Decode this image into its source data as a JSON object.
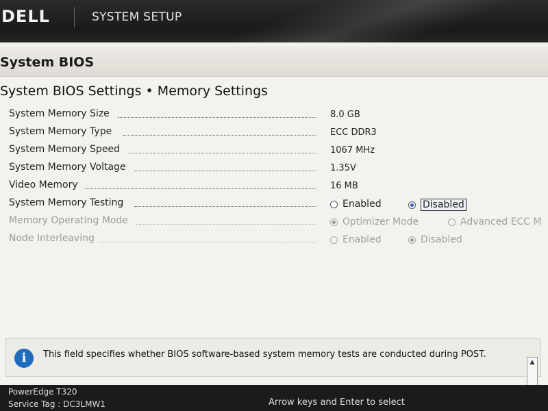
{
  "header": {
    "logo_text": "DELL",
    "app_title": "SYSTEM SETUP"
  },
  "page": {
    "section_title": "System BIOS",
    "sub_title": "System BIOS Settings • Memory Settings"
  },
  "settings": [
    {
      "label": "System Memory Size",
      "value": "8.0 GB"
    },
    {
      "label": "System Memory Type",
      "value": "ECC DDR3"
    },
    {
      "label": "System Memory Speed",
      "value": "1067 MHz"
    },
    {
      "label": "System Memory Voltage",
      "value": "1.35V"
    },
    {
      "label": "Video Memory",
      "value": "16 MB"
    },
    {
      "label": "System Memory Testing",
      "options": [
        "Enabled",
        "Disabled"
      ],
      "selected": "Disabled",
      "enabled": true
    },
    {
      "label": "Memory Operating Mode",
      "options": [
        "Optimizer Mode",
        "Advanced ECC M"
      ],
      "selected": "Optimizer Mode",
      "enabled": false
    },
    {
      "label": "Node Interleaving",
      "options": [
        "Enabled",
        "Disabled"
      ],
      "selected": "Disabled",
      "enabled": false
    }
  ],
  "help": {
    "icon": "info-icon",
    "text": "This field specifies whether BIOS software-based system memory tests are conducted during POST."
  },
  "footer": {
    "model": "PowerEdge T320",
    "service_tag": "Service Tag : DC3LMW1",
    "hint": "Arrow keys and Enter to select"
  },
  "colors": {
    "accent": "#1f6bbf",
    "page_bg": "#f3f2ee",
    "header_bg": "#1a1a1a"
  }
}
